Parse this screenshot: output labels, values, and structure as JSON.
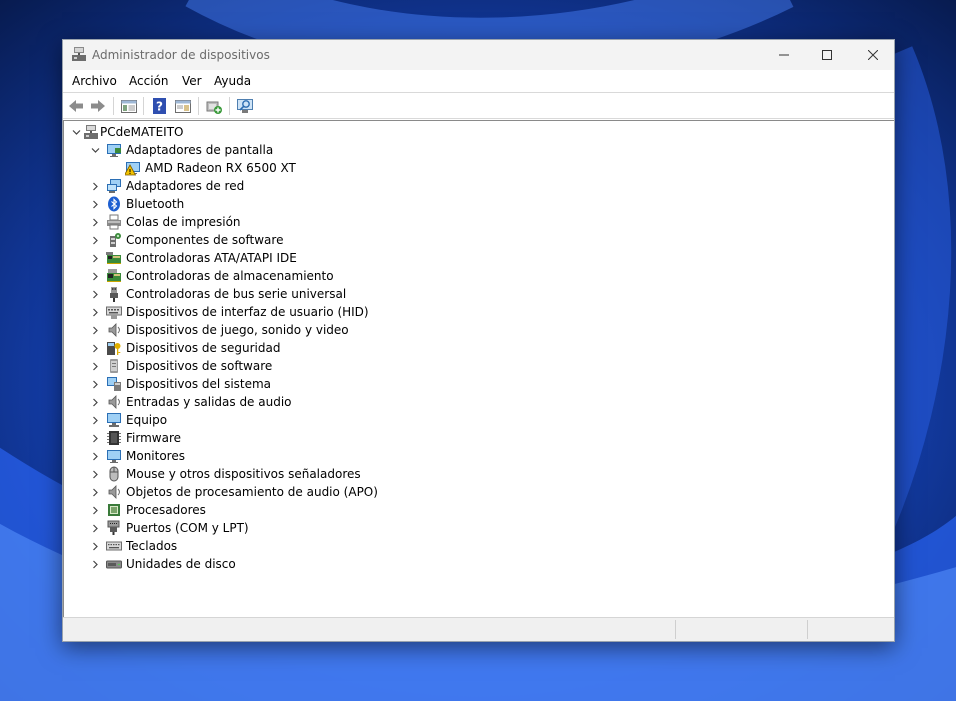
{
  "window": {
    "title": "Administrador de dispositivos"
  },
  "menu": [
    "Archivo",
    "Acción",
    "Ver",
    "Ayuda"
  ],
  "toolbar": {
    "buttons": [
      "back-arrow-icon",
      "forward-arrow-icon",
      "show-hide-tree-icon",
      "help-icon",
      "properties-icon",
      "update-driver-icon",
      "scan-hardware-icon"
    ]
  },
  "tree": {
    "root": "PCdeMATEITO",
    "categories": [
      {
        "label": "Adaptadores de pantalla",
        "icon": "display-adapter-icon",
        "expanded": true,
        "children": [
          {
            "label": "AMD Radeon RX 6500 XT",
            "icon": "warning-display-icon"
          }
        ]
      },
      {
        "label": "Adaptadores de red",
        "icon": "network-adapter-icon"
      },
      {
        "label": "Bluetooth",
        "icon": "bluetooth-icon"
      },
      {
        "label": "Colas de impresión",
        "icon": "printer-icon"
      },
      {
        "label": "Componentes de software",
        "icon": "software-component-icon"
      },
      {
        "label": "Controladoras ATA/ATAPI IDE",
        "icon": "ide-controller-icon"
      },
      {
        "label": "Controladoras de almacenamiento",
        "icon": "storage-controller-icon"
      },
      {
        "label": "Controladoras de bus serie universal",
        "icon": "usb-icon"
      },
      {
        "label": "Dispositivos de interfaz de usuario (HID)",
        "icon": "hid-icon"
      },
      {
        "label": "Dispositivos de juego, sonido y video",
        "icon": "speaker-icon"
      },
      {
        "label": "Dispositivos de seguridad",
        "icon": "security-key-icon"
      },
      {
        "label": "Dispositivos de software",
        "icon": "software-device-icon"
      },
      {
        "label": "Dispositivos del sistema",
        "icon": "system-device-icon"
      },
      {
        "label": "Entradas y salidas de audio",
        "icon": "speaker-icon"
      },
      {
        "label": "Equipo",
        "icon": "computer-icon"
      },
      {
        "label": "Firmware",
        "icon": "firmware-chip-icon"
      },
      {
        "label": "Monitores",
        "icon": "monitor-icon"
      },
      {
        "label": "Mouse y otros dispositivos señaladores",
        "icon": "mouse-icon"
      },
      {
        "label": "Objetos de procesamiento de audio (APO)",
        "icon": "speaker-icon"
      },
      {
        "label": "Procesadores",
        "icon": "processor-icon"
      },
      {
        "label": "Puertos (COM y LPT)",
        "icon": "port-icon"
      },
      {
        "label": "Teclados",
        "icon": "keyboard-icon"
      },
      {
        "label": "Unidades de disco",
        "icon": "disk-drive-icon"
      }
    ]
  },
  "colors": {
    "accent": "#0078d4",
    "wallpaper": "#0b2a78",
    "warning": "#f2c200"
  }
}
